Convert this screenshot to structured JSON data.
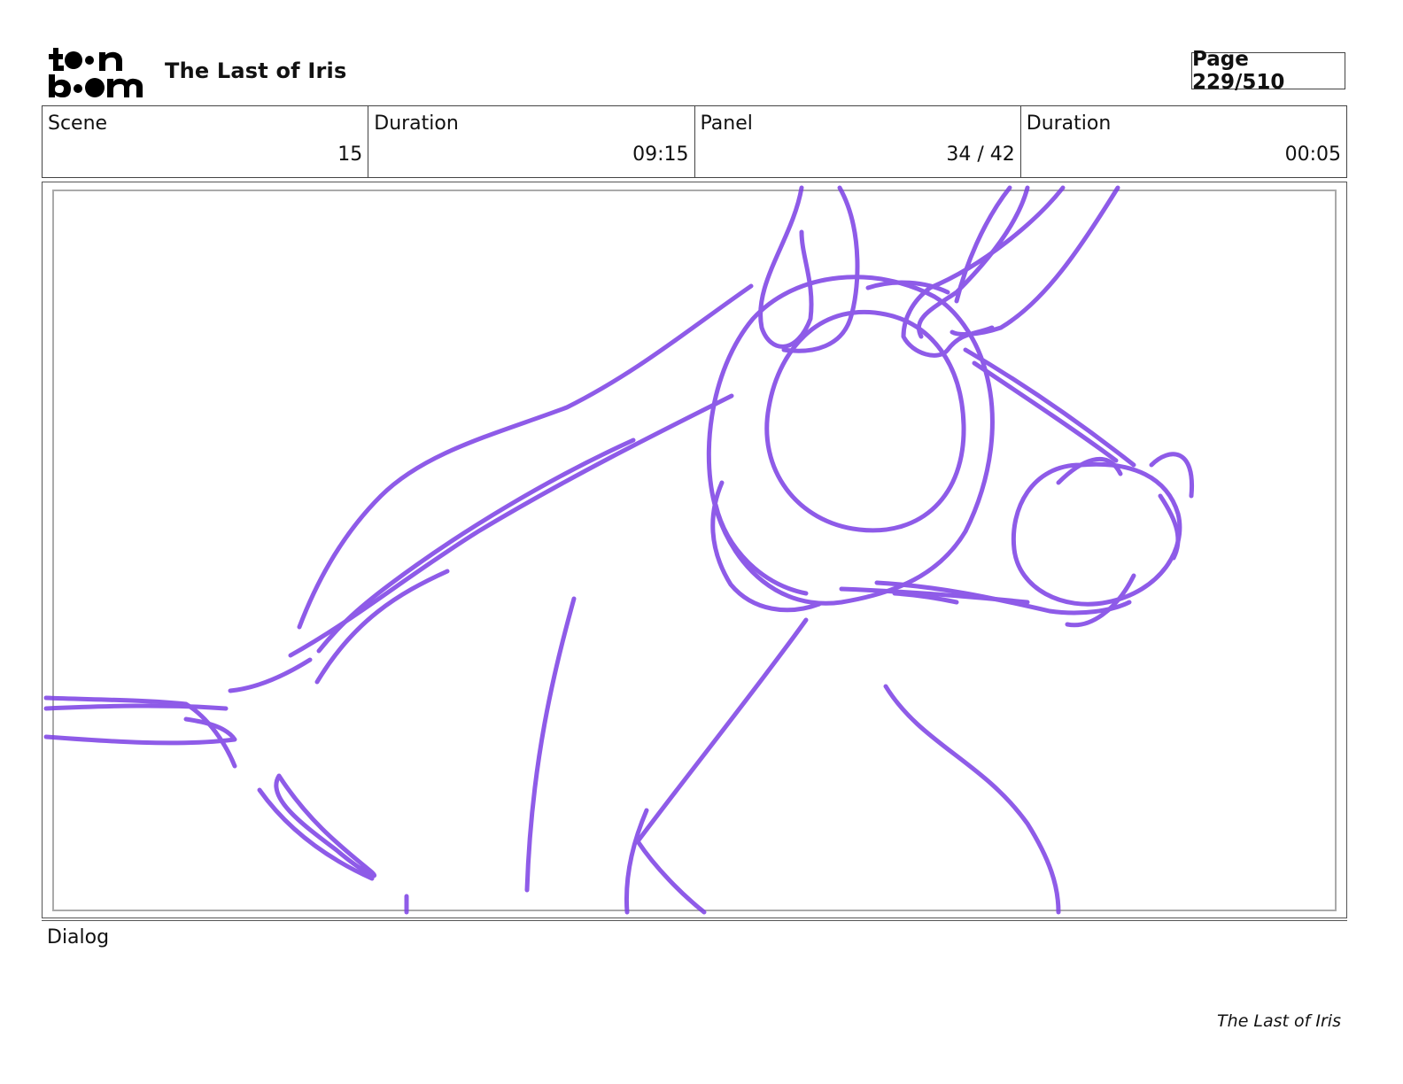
{
  "header": {
    "logo_name": "toon boom",
    "title": "The Last of Iris",
    "page_label": "Page 229/510"
  },
  "info": {
    "scene_label": "Scene",
    "scene_value": "15",
    "scene_duration_label": "Duration",
    "scene_duration_value": "09:15",
    "panel_label": "Panel",
    "panel_value": "34 / 42",
    "panel_duration_label": "Duration",
    "panel_duration_value": "00:05"
  },
  "panel": {
    "sketch_subject": "rough horse head sketch",
    "stroke_color": "#7b3fe4"
  },
  "dialog": {
    "label": "Dialog"
  },
  "footer": {
    "title": "The Last of Iris"
  }
}
